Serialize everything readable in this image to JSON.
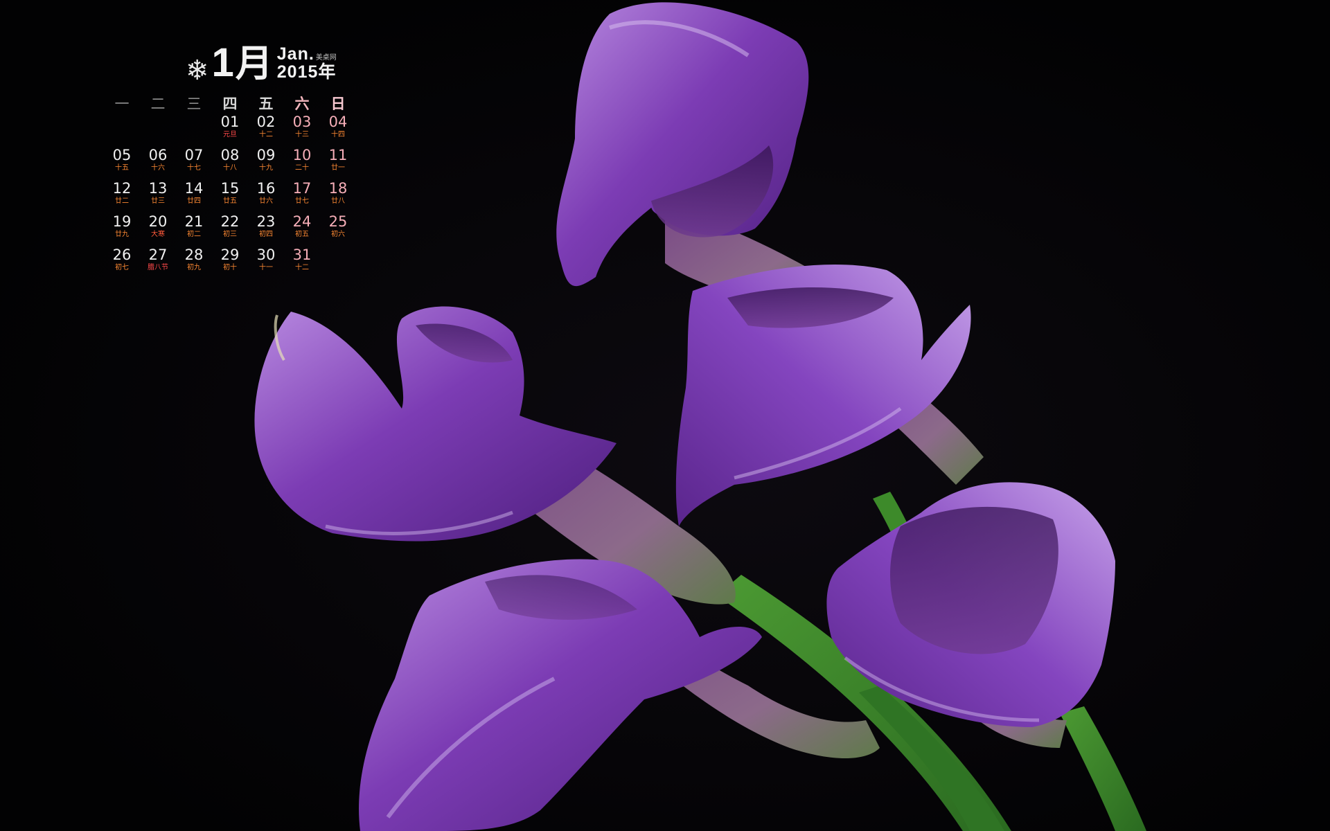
{
  "header": {
    "snow_icon": "❄",
    "month_number": "1",
    "month_cn": "月",
    "month_en": "Jan.",
    "brand": "美桌网",
    "year": "2015年"
  },
  "weekdays": [
    {
      "label": "一",
      "style": "muted"
    },
    {
      "label": "二",
      "style": "muted"
    },
    {
      "label": "三",
      "style": "muted"
    },
    {
      "label": "四",
      "style": "normal"
    },
    {
      "label": "五",
      "style": "normal"
    },
    {
      "label": "六",
      "style": "sat"
    },
    {
      "label": "日",
      "style": "sun"
    }
  ],
  "weeks": [
    [
      null,
      null,
      null,
      {
        "day": "01",
        "lunar": "元旦",
        "festival": true
      },
      {
        "day": "02",
        "lunar": "十二"
      },
      {
        "day": "03",
        "lunar": "十三",
        "weekend": true
      },
      {
        "day": "04",
        "lunar": "十四",
        "weekend": true
      }
    ],
    [
      {
        "day": "05",
        "lunar": "十五"
      },
      {
        "day": "06",
        "lunar": "十六"
      },
      {
        "day": "07",
        "lunar": "十七"
      },
      {
        "day": "08",
        "lunar": "十八"
      },
      {
        "day": "09",
        "lunar": "十九"
      },
      {
        "day": "10",
        "lunar": "二十",
        "weekend": true
      },
      {
        "day": "11",
        "lunar": "廿一",
        "weekend": true
      }
    ],
    [
      {
        "day": "12",
        "lunar": "廿二"
      },
      {
        "day": "13",
        "lunar": "廿三"
      },
      {
        "day": "14",
        "lunar": "廿四"
      },
      {
        "day": "15",
        "lunar": "廿五"
      },
      {
        "day": "16",
        "lunar": "廿六"
      },
      {
        "day": "17",
        "lunar": "廿七",
        "weekend": true
      },
      {
        "day": "18",
        "lunar": "廿八",
        "weekend": true
      }
    ],
    [
      {
        "day": "19",
        "lunar": "廿九"
      },
      {
        "day": "20",
        "lunar": "大寒",
        "term": true
      },
      {
        "day": "21",
        "lunar": "初二"
      },
      {
        "day": "22",
        "lunar": "初三"
      },
      {
        "day": "23",
        "lunar": "初四"
      },
      {
        "day": "24",
        "lunar": "初五",
        "weekend": true
      },
      {
        "day": "25",
        "lunar": "初六",
        "weekend": true
      }
    ],
    [
      {
        "day": "26",
        "lunar": "初七"
      },
      {
        "day": "27",
        "lunar": "腊八节",
        "festival": true
      },
      {
        "day": "28",
        "lunar": "初九"
      },
      {
        "day": "29",
        "lunar": "初十"
      },
      {
        "day": "30",
        "lunar": "十一"
      },
      {
        "day": "31",
        "lunar": "十二",
        "weekend": true
      },
      null
    ]
  ],
  "colors": {
    "background": "#040305",
    "petal": "#7a3fb0",
    "petal_light": "#c9a6e6",
    "stem": "#3f8a2c",
    "lunar": "#ff8a33",
    "weekend": "#f6aeb8"
  }
}
